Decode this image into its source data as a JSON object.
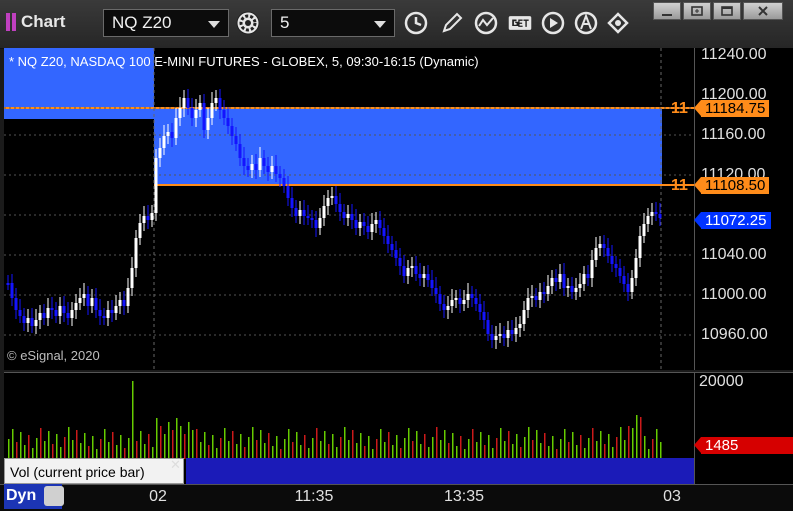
{
  "window": {
    "title": "Chart"
  },
  "toolbar": {
    "symbol": "NQ Z20",
    "interval": "5",
    "icons": [
      "settings-gear-icon",
      "clock-icon",
      "draw-pencil-icon",
      "study-chart-icon",
      "get-data-icon",
      "play-icon",
      "auto-scale-icon",
      "link-arrows-icon"
    ],
    "window_buttons": [
      "minimize-icon",
      "restore-icon",
      "maximize-icon",
      "close-icon"
    ]
  },
  "chart": {
    "header": "* NQ Z20, NASDAQ 100 E-MINI FUTURES - GLOBEX, 5, 09:30-16:15 (Dynamic)",
    "watermark": "© eSignal, 2020",
    "price_ticks": [
      "11240.00",
      "11200.00",
      "11160.00",
      "11120.00",
      "11080.00",
      "11040.00",
      "11000.00",
      "10960.00"
    ],
    "markers": {
      "high": "11184.75",
      "low": "11108.50",
      "last": "11072.25",
      "high_prefix": "11",
      "low_prefix": "11"
    },
    "volume": {
      "panel_label": "Vol (current price bar)",
      "close_symbol": "✕",
      "tick": "20000",
      "last": "1485"
    },
    "time_ticks": [
      "02",
      "11:35",
      "13:35",
      "03"
    ],
    "bottom_button": "Dyn",
    "colors": {
      "up_bar": "#ffffff",
      "down_bar": "#1414ff",
      "band": "#3366ff",
      "level_line": "#ff8c1a",
      "vol_up": "#66cc00",
      "vol_down": "#cc1a1a"
    }
  }
}
